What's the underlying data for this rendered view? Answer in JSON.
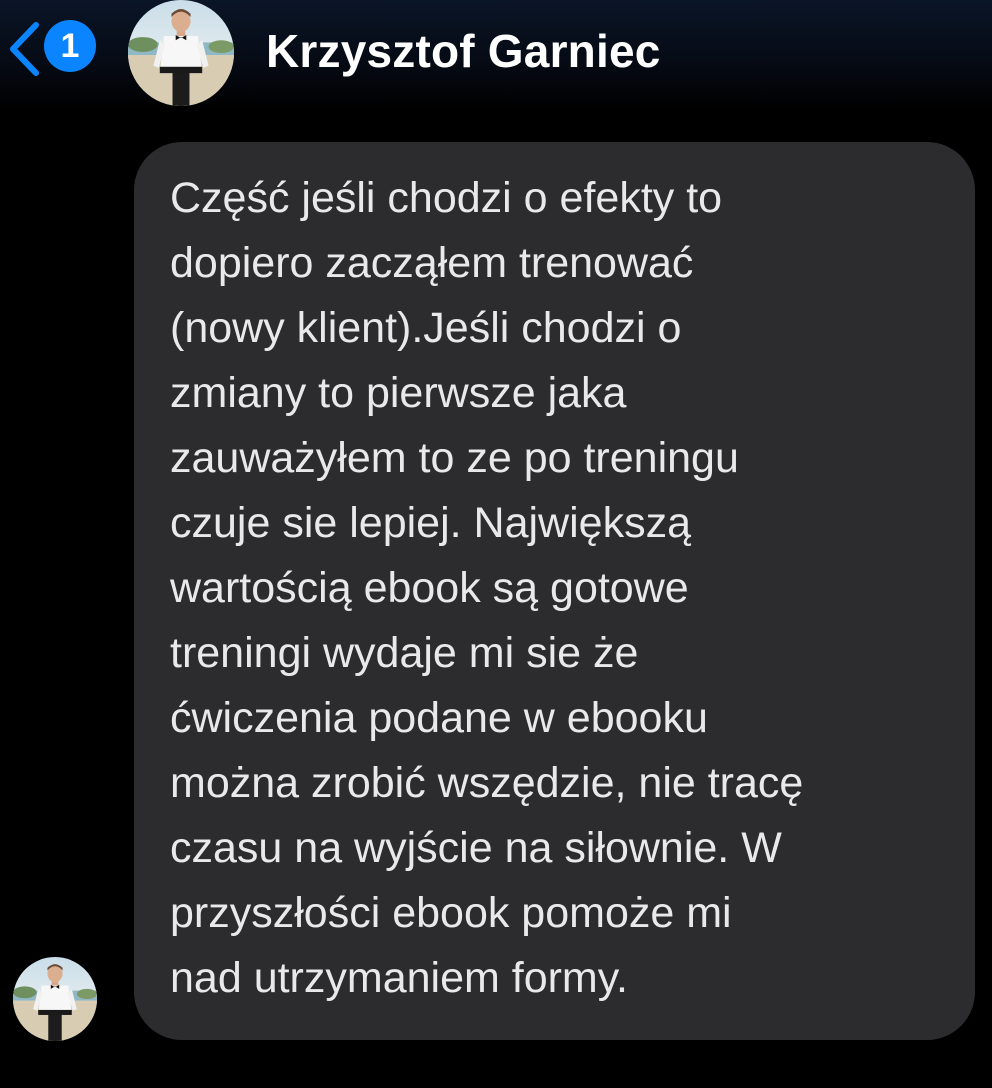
{
  "header": {
    "back_icon": "chevron-left-icon",
    "unread_count": "1",
    "contact_name": "Krzysztof Garniec",
    "avatar_icon": "contact-avatar"
  },
  "conversation": {
    "messages": [
      {
        "direction": "incoming",
        "text": "Część jeśli chodzi o efekty to\ndopiero zacząłem trenować\n(nowy klient).Jeśli chodzi o\nzmiany to pierwsze jaka\nzauważyłem to ze po treningu\nczuje sie lepiej. Największą\nwartością ebook są gotowe\ntreningi wydaje mi sie że\nćwiczenia podane w ebooku\nmożna zrobić wszędzie, nie tracę\nczasu na wyjście na siłownie. W\nprzyszłości ebook pomoże mi\nnad utrzymaniem formy."
      }
    ]
  },
  "colors": {
    "accent": "#0a84ff",
    "bubble": "#2c2c2e",
    "background": "#000000",
    "text": "#e9e9eb"
  }
}
